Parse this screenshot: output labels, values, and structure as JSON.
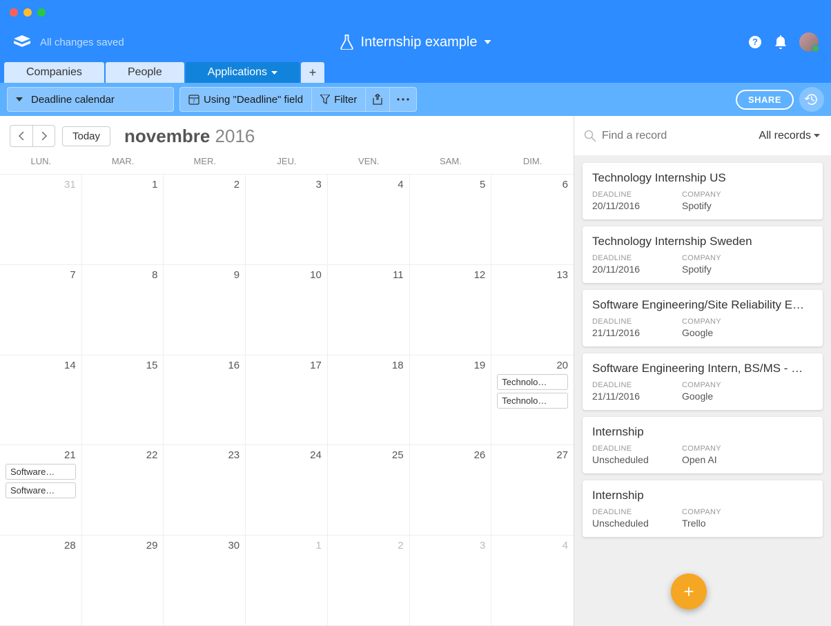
{
  "header": {
    "saved_text": "All changes saved",
    "base_name": "Internship example"
  },
  "tabs": [
    {
      "label": "Companies",
      "active": false
    },
    {
      "label": "People",
      "active": false
    },
    {
      "label": "Applications",
      "active": true
    }
  ],
  "toolbar": {
    "view_name": "Deadline calendar",
    "using_field": "Using \"Deadline\" field",
    "filter": "Filter",
    "share": "SHARE"
  },
  "calendar": {
    "today_label": "Today",
    "month": "novembre",
    "year": "2016",
    "day_headers": [
      "LUN.",
      "MAR.",
      "MER.",
      "JEU.",
      "VEN.",
      "SAM.",
      "DIM."
    ],
    "weeks": [
      [
        {
          "d": "31",
          "off": true
        },
        {
          "d": "1"
        },
        {
          "d": "2"
        },
        {
          "d": "3"
        },
        {
          "d": "4"
        },
        {
          "d": "5"
        },
        {
          "d": "6"
        }
      ],
      [
        {
          "d": "7"
        },
        {
          "d": "8"
        },
        {
          "d": "9"
        },
        {
          "d": "10"
        },
        {
          "d": "11"
        },
        {
          "d": "12"
        },
        {
          "d": "13"
        }
      ],
      [
        {
          "d": "14"
        },
        {
          "d": "15"
        },
        {
          "d": "16"
        },
        {
          "d": "17"
        },
        {
          "d": "18"
        },
        {
          "d": "19"
        },
        {
          "d": "20",
          "events": [
            "Technolo…",
            "Technolo…"
          ]
        }
      ],
      [
        {
          "d": "21",
          "events": [
            "Software…",
            "Software…"
          ]
        },
        {
          "d": "22"
        },
        {
          "d": "23"
        },
        {
          "d": "24"
        },
        {
          "d": "25"
        },
        {
          "d": "26"
        },
        {
          "d": "27"
        }
      ],
      [
        {
          "d": "28"
        },
        {
          "d": "29"
        },
        {
          "d": "30"
        },
        {
          "d": "1",
          "off": true
        },
        {
          "d": "2",
          "off": true
        },
        {
          "d": "3",
          "off": true
        },
        {
          "d": "4",
          "off": true
        }
      ]
    ]
  },
  "side": {
    "search_placeholder": "Find a record",
    "records_label": "All records",
    "field_labels": {
      "deadline": "DEADLINE",
      "company": "COMPANY"
    },
    "cards": [
      {
        "title": "Technology Internship US",
        "deadline": "20/11/2016",
        "company": "Spotify"
      },
      {
        "title": "Technology Internship Sweden",
        "deadline": "20/11/2016",
        "company": "Spotify"
      },
      {
        "title": "Software Engineering/Site Reliability E…",
        "deadline": "21/11/2016",
        "company": "Google"
      },
      {
        "title": "Software Engineering Intern, BS/MS - …",
        "deadline": "21/11/2016",
        "company": "Google"
      },
      {
        "title": "Internship",
        "deadline": "Unscheduled",
        "company": "Open AI"
      },
      {
        "title": "Internship",
        "deadline": "Unscheduled",
        "company": "Trello"
      }
    ]
  }
}
